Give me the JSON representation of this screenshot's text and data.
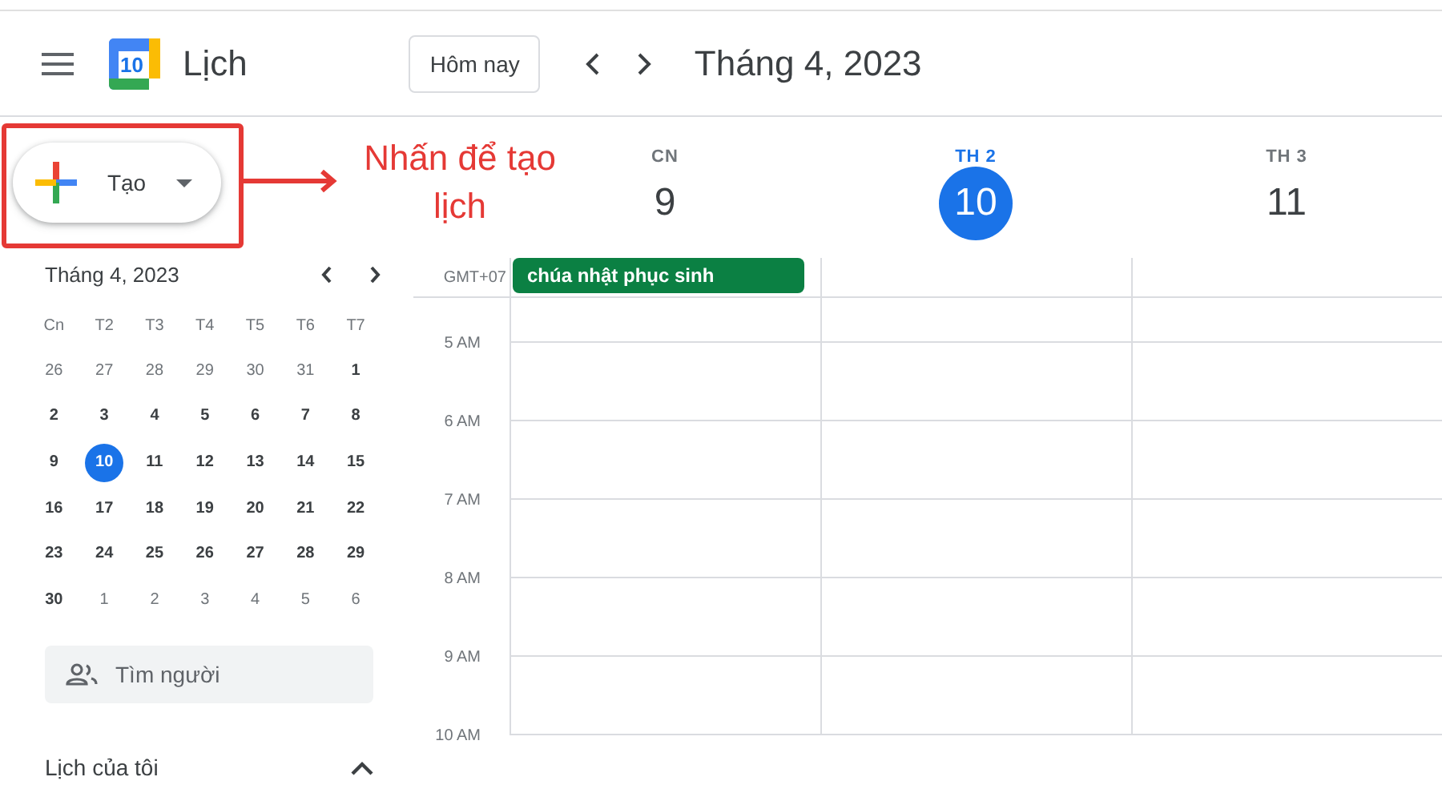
{
  "header": {
    "app_name": "Lịch",
    "logo_day": "10",
    "today_button": "Hôm nay",
    "title": "Tháng 4, 2023"
  },
  "create_button": {
    "label": "Tạo"
  },
  "annotation": {
    "text": "Nhấn để tạo lịch"
  },
  "mini_calendar": {
    "title": "Tháng 4, 2023",
    "weekdays": [
      "Cn",
      "T2",
      "T3",
      "T4",
      "T5",
      "T6",
      "T7"
    ],
    "weeks": [
      [
        {
          "label": "26",
          "in_month": false,
          "selected": false
        },
        {
          "label": "27",
          "in_month": false,
          "selected": false
        },
        {
          "label": "28",
          "in_month": false,
          "selected": false
        },
        {
          "label": "29",
          "in_month": false,
          "selected": false
        },
        {
          "label": "30",
          "in_month": false,
          "selected": false
        },
        {
          "label": "31",
          "in_month": false,
          "selected": false
        },
        {
          "label": "1",
          "in_month": true,
          "selected": false
        }
      ],
      [
        {
          "label": "2",
          "in_month": true,
          "selected": false
        },
        {
          "label": "3",
          "in_month": true,
          "selected": false
        },
        {
          "label": "4",
          "in_month": true,
          "selected": false
        },
        {
          "label": "5",
          "in_month": true,
          "selected": false
        },
        {
          "label": "6",
          "in_month": true,
          "selected": false
        },
        {
          "label": "7",
          "in_month": true,
          "selected": false
        },
        {
          "label": "8",
          "in_month": true,
          "selected": false
        }
      ],
      [
        {
          "label": "9",
          "in_month": true,
          "selected": false
        },
        {
          "label": "10",
          "in_month": true,
          "selected": true
        },
        {
          "label": "11",
          "in_month": true,
          "selected": false
        },
        {
          "label": "12",
          "in_month": true,
          "selected": false
        },
        {
          "label": "13",
          "in_month": true,
          "selected": false
        },
        {
          "label": "14",
          "in_month": true,
          "selected": false
        },
        {
          "label": "15",
          "in_month": true,
          "selected": false
        }
      ],
      [
        {
          "label": "16",
          "in_month": true,
          "selected": false
        },
        {
          "label": "17",
          "in_month": true,
          "selected": false
        },
        {
          "label": "18",
          "in_month": true,
          "selected": false
        },
        {
          "label": "19",
          "in_month": true,
          "selected": false
        },
        {
          "label": "20",
          "in_month": true,
          "selected": false
        },
        {
          "label": "21",
          "in_month": true,
          "selected": false
        },
        {
          "label": "22",
          "in_month": true,
          "selected": false
        }
      ],
      [
        {
          "label": "23",
          "in_month": true,
          "selected": false
        },
        {
          "label": "24",
          "in_month": true,
          "selected": false
        },
        {
          "label": "25",
          "in_month": true,
          "selected": false
        },
        {
          "label": "26",
          "in_month": true,
          "selected": false
        },
        {
          "label": "27",
          "in_month": true,
          "selected": false
        },
        {
          "label": "28",
          "in_month": true,
          "selected": false
        },
        {
          "label": "29",
          "in_month": true,
          "selected": false
        }
      ],
      [
        {
          "label": "30",
          "in_month": true,
          "selected": false
        },
        {
          "label": "1",
          "in_month": false,
          "selected": false
        },
        {
          "label": "2",
          "in_month": false,
          "selected": false
        },
        {
          "label": "3",
          "in_month": false,
          "selected": false
        },
        {
          "label": "4",
          "in_month": false,
          "selected": false
        },
        {
          "label": "5",
          "in_month": false,
          "selected": false
        },
        {
          "label": "6",
          "in_month": false,
          "selected": false
        }
      ]
    ]
  },
  "people_search": {
    "placeholder": "Tìm người"
  },
  "my_calendars": {
    "label": "Lịch của tôi",
    "expanded": true
  },
  "timezone": "GMT+07",
  "days": [
    {
      "weekday": "CN",
      "date": "9",
      "selected": false,
      "all_day_event": {
        "title": "chúa nhật phục sinh",
        "color": "#0b8043"
      }
    },
    {
      "weekday": "TH 2",
      "date": "10",
      "selected": true
    },
    {
      "weekday": "TH 3",
      "date": "11",
      "selected": false
    }
  ],
  "hours": [
    "5 AM",
    "6 AM",
    "7 AM",
    "8 AM",
    "9 AM",
    "10 AM"
  ]
}
